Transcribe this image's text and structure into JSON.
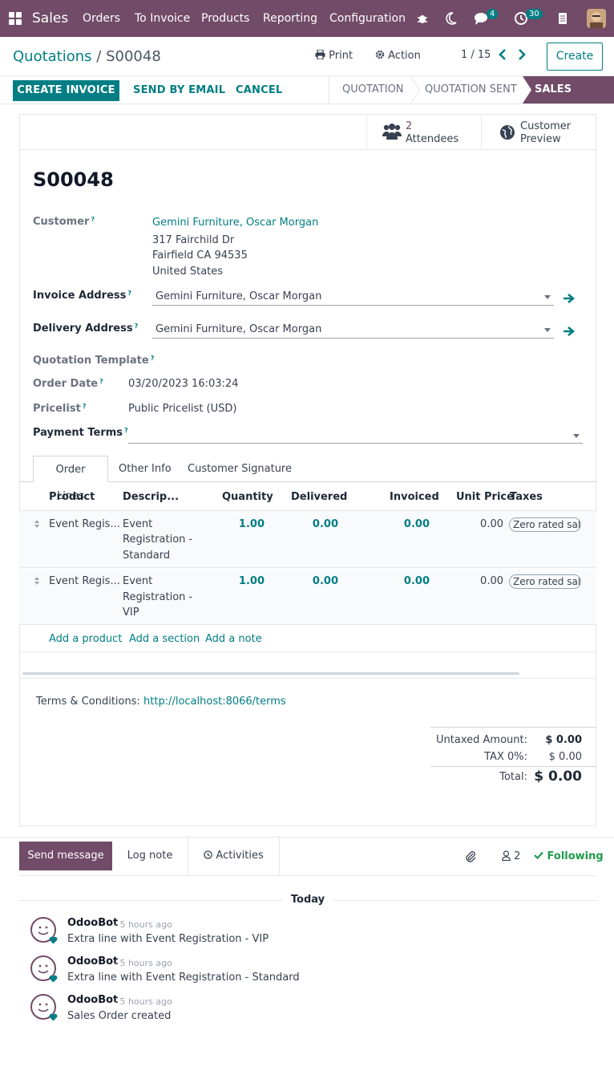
{
  "navbar": {
    "app": "Sales",
    "menus": [
      "Orders",
      "To Invoice",
      "Products",
      "Reporting",
      "Configuration"
    ],
    "chat_count": "4",
    "activity_count": "30"
  },
  "control": {
    "breadcrumb_parent": "Quotations",
    "breadcrumb_sep": "/",
    "breadcrumb_current": "S00048",
    "print": "Print",
    "action": "Action",
    "pager": "1 / 15",
    "create": "Create"
  },
  "statusbar": {
    "create_invoice": "CREATE INVOICE",
    "send_email": "SEND BY EMAIL",
    "cancel": "CANCEL",
    "stages": [
      "QUOTATION",
      "QUOTATION SENT",
      "SALES ORDER"
    ]
  },
  "smart": {
    "attendees_count": "2",
    "attendees_label": "Attendees",
    "preview_line1": "Customer",
    "preview_line2": "Preview"
  },
  "form": {
    "name": "S00048",
    "customer_label": "Customer",
    "customer_name": "Gemini Furniture, Oscar Morgan",
    "address": [
      "317 Fairchild Dr",
      "Fairfield CA 94535",
      "United States"
    ],
    "invoice_label": "Invoice Address",
    "invoice_value": "Gemini Furniture, Oscar Morgan",
    "delivery_label": "Delivery Address",
    "delivery_value": "Gemini Furniture, Oscar Morgan",
    "template_label": "Quotation Template",
    "order_date_label": "Order Date",
    "order_date": "03/20/2023 16:03:24",
    "pricelist_label": "Pricelist",
    "pricelist": "Public Pricelist (USD)",
    "payment_label": "Payment Terms",
    "help": "?"
  },
  "tabs": [
    "Order Lines",
    "Other Info",
    "Customer Signature"
  ],
  "table": {
    "headers": [
      "Product",
      "Descrip...",
      "Quantity",
      "Delivered",
      "Invoiced",
      "Unit Price",
      "Taxes"
    ],
    "rows": [
      {
        "product": "Event Regis...",
        "desc": [
          "Event",
          "Registration -",
          "Standard"
        ],
        "qty": "1.00",
        "delivered": "0.00",
        "invoiced": "0.00",
        "price": "0.00",
        "tax": "Zero rated sales"
      },
      {
        "product": "Event Regis...",
        "desc": [
          "Event",
          "Registration -",
          "VIP"
        ],
        "qty": "1.00",
        "delivered": "0.00",
        "invoiced": "0.00",
        "price": "0.00",
        "tax": "Zero rated sales"
      }
    ],
    "add_product": "Add a product",
    "add_section": "Add a section",
    "add_note": "Add a note"
  },
  "footer": {
    "terms_label": "Terms & Conditions:",
    "terms_link": "http://localhost:8066/terms",
    "untaxed_label": "Untaxed Amount:",
    "untaxed_value": "$ 0.00",
    "tax_label": "TAX 0%:",
    "tax_value": "$ 0.00",
    "total_label": "Total:",
    "total_value": "$ 0.00"
  },
  "chatter": {
    "send_message": "Send message",
    "log_note": "Log note",
    "activities": "Activities",
    "followers": "2",
    "following": "Following",
    "today": "Today",
    "messages": [
      {
        "author": "OdooBot",
        "time": "- 5 hours ago",
        "body": "Extra line with Event Registration - VIP"
      },
      {
        "author": "OdooBot",
        "time": "- 5 hours ago",
        "body": "Extra line with Event Registration - Standard"
      },
      {
        "author": "OdooBot",
        "time": "- 5 hours ago",
        "body": "Sales Order created"
      }
    ]
  },
  "colors": {
    "brand": "#714b67",
    "accent": "#017e84"
  }
}
